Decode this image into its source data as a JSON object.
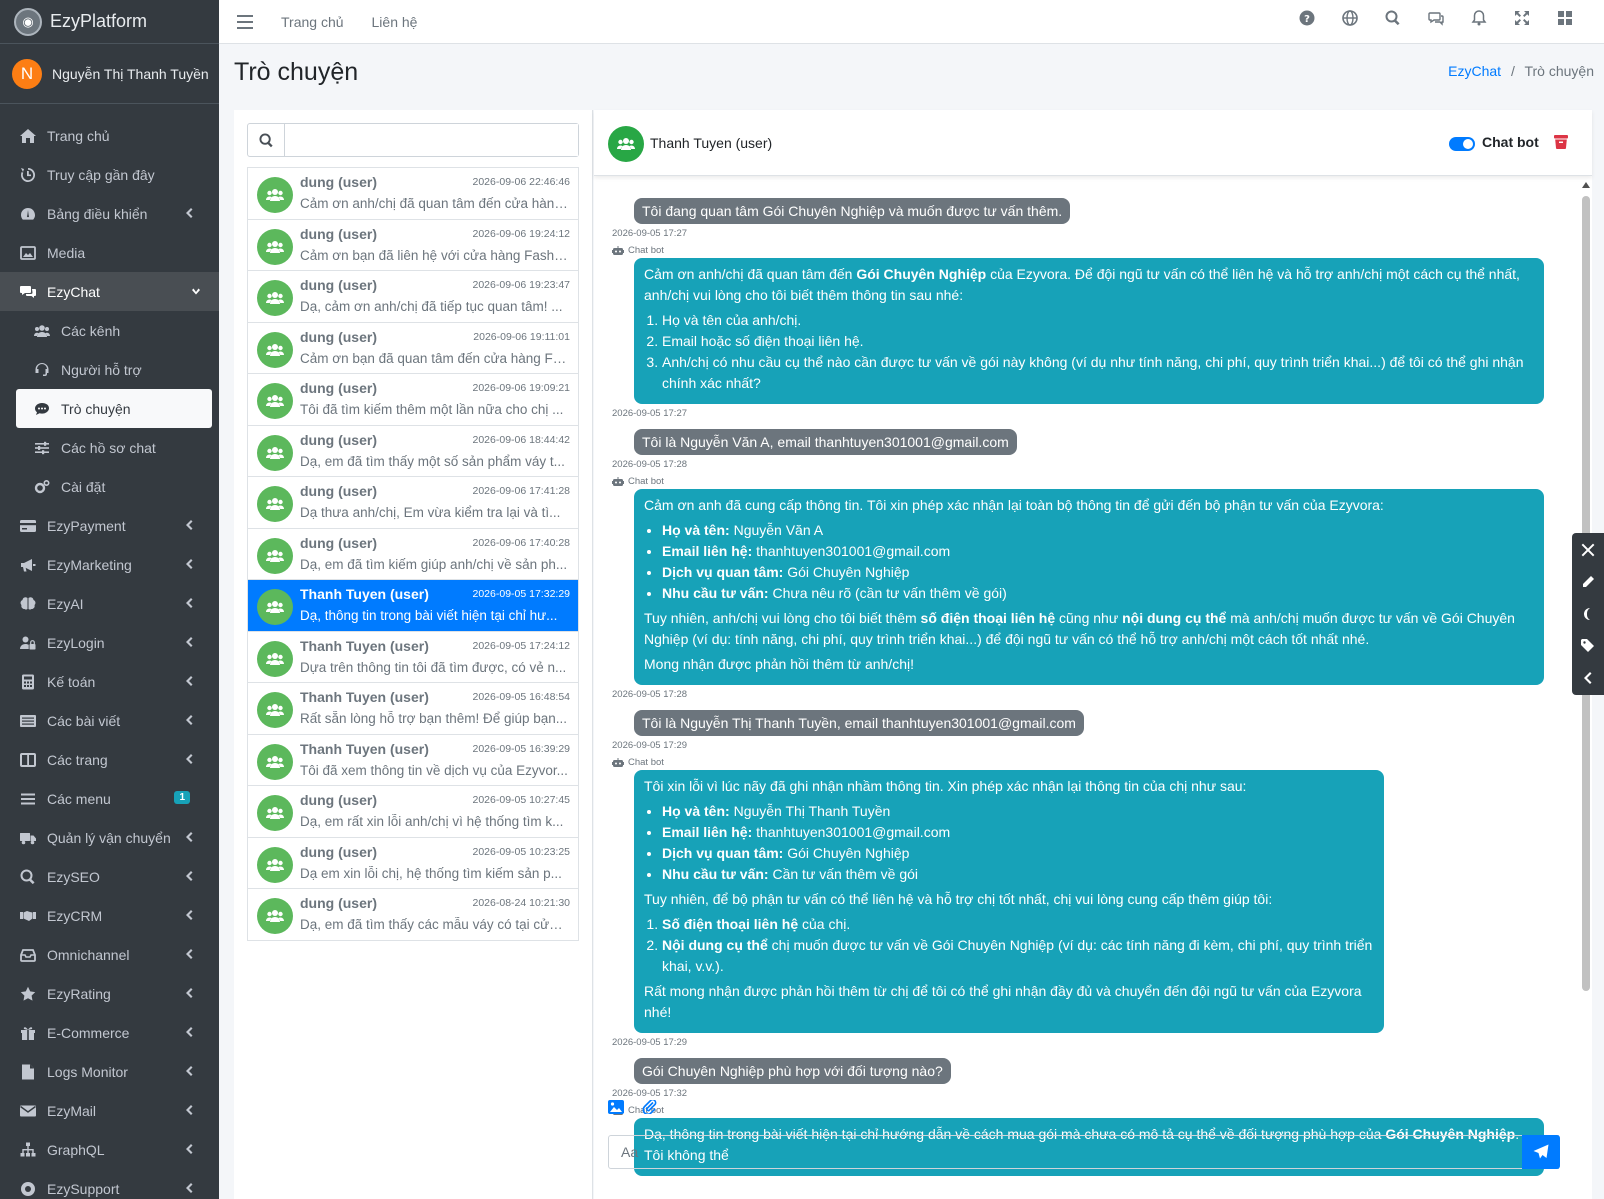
{
  "brand": {
    "name": "EzyPlatform",
    "logo_icon": "logo-icon"
  },
  "user": {
    "initial": "N",
    "name": "Nguyễn Thị Thanh Tuyền",
    "avatar_color": "#fd7e14"
  },
  "sidebar": {
    "items": [
      {
        "label": "Trang chủ",
        "icon": "home-icon"
      },
      {
        "label": "Truy cập gần đây",
        "icon": "history-icon"
      },
      {
        "label": "Bảng điều khiển",
        "icon": "dashboard-icon",
        "has_children": true
      },
      {
        "label": "Media",
        "icon": "image-icon"
      },
      {
        "label": "EzyChat",
        "icon": "comments-icon",
        "expanded": true
      },
      {
        "label": "Các kênh",
        "icon": "users-icon",
        "sub": true
      },
      {
        "label": "Người hỗ trợ",
        "icon": "headset-icon",
        "sub": true
      },
      {
        "label": "Trò chuyện",
        "icon": "comment-icon",
        "sub": true,
        "active": true
      },
      {
        "label": "Các hồ sơ chat",
        "icon": "sliders-icon",
        "sub": true
      },
      {
        "label": "Cài đặt",
        "icon": "cogs-icon",
        "sub": true
      },
      {
        "label": "EzyPayment",
        "icon": "card-icon",
        "has_children": true
      },
      {
        "label": "EzyMarketing",
        "icon": "bullhorn-icon",
        "has_children": true
      },
      {
        "label": "EzyAI",
        "icon": "brain-icon",
        "has_children": true
      },
      {
        "label": "EzyLogin",
        "icon": "user-lock-icon",
        "has_children": true
      },
      {
        "label": "Kế toán",
        "icon": "calculator-icon",
        "has_children": true
      },
      {
        "label": "Các bài viết",
        "icon": "list-icon",
        "has_children": true
      },
      {
        "label": "Các trang",
        "icon": "columns-icon",
        "has_children": true
      },
      {
        "label": "Các menu",
        "icon": "bars-icon",
        "badge": "1"
      },
      {
        "label": "Quản lý vận chuyển",
        "icon": "truck-icon",
        "has_children": true
      },
      {
        "label": "EzySEO",
        "icon": "search-icon",
        "has_children": true
      },
      {
        "label": "EzyCRM",
        "icon": "handshake-icon",
        "has_children": true
      },
      {
        "label": "Omnichannel",
        "icon": "inbox-icon",
        "has_children": true
      },
      {
        "label": "EzyRating",
        "icon": "star-icon",
        "has_children": true
      },
      {
        "label": "E-Commerce",
        "icon": "gift-icon",
        "has_children": true
      },
      {
        "label": "Logs Monitor",
        "icon": "file-icon",
        "has_children": true
      },
      {
        "label": "EzyMail",
        "icon": "envelope-icon",
        "has_children": true
      },
      {
        "label": "GraphQL",
        "icon": "sitemap-icon",
        "has_children": true
      },
      {
        "label": "EzySupport",
        "icon": "support-icon",
        "has_children": true
      }
    ]
  },
  "topbar": {
    "home": "Trang chủ",
    "contact": "Liên hệ",
    "icons": [
      "help-icon",
      "globe-icon",
      "search-icon",
      "chat-icon",
      "bell-icon",
      "expand-icon",
      "apps-icon"
    ]
  },
  "page": {
    "title": "Trò chuyện",
    "breadcrumb_root": "EzyChat",
    "breadcrumb_sep": "/",
    "breadcrumb_current": "Trò chuyện"
  },
  "search": {
    "placeholder": ""
  },
  "conversations": [
    {
      "name": "dung (user)",
      "time": "2026-09-06 22:46:46",
      "preview": "Cảm ơn anh/chị đã quan tâm đến cửa hàng Fashion..."
    },
    {
      "name": "dung (user)",
      "time": "2026-09-06 19:24:12",
      "preview": "Cảm ơn bạn đã liên hệ với cửa hàng Fashion..."
    },
    {
      "name": "dung (user)",
      "time": "2026-09-06 19:23:47",
      "preview": "Dạ, cảm ơn anh/chị đã tiếp tục quan tâm! ..."
    },
    {
      "name": "dung (user)",
      "time": "2026-09-06 19:11:01",
      "preview": "Cảm ơn bạn đã quan tâm đến cửa hàng Fa..."
    },
    {
      "name": "dung (user)",
      "time": "2026-09-06 19:09:21",
      "preview": "Tôi đã tìm kiếm thêm một lần nữa cho chị ..."
    },
    {
      "name": "dung (user)",
      "time": "2026-09-06 18:44:42",
      "preview": "Dạ, em đã tìm thấy một số sản phẩm váy t..."
    },
    {
      "name": "dung (user)",
      "time": "2026-09-06 17:41:28",
      "preview": "Dạ thưa anh/chị, Em vừa kiểm tra lại và tì..."
    },
    {
      "name": "dung (user)",
      "time": "2026-09-06 17:40:28",
      "preview": "Dạ, em đã tìm kiếm giúp anh/chị về sản ph..."
    },
    {
      "name": "Thanh Tuyen (user)",
      "time": "2026-09-05 17:32:29",
      "preview": "Dạ, thông tin trong bài viết hiện tại chỉ hư...",
      "selected": true
    },
    {
      "name": "Thanh Tuyen (user)",
      "time": "2026-09-05 17:24:12",
      "preview": "Dựa trên thông tin tôi đã tìm được, có vẻ n..."
    },
    {
      "name": "Thanh Tuyen (user)",
      "time": "2026-09-05 16:48:54",
      "preview": "Rất sẵn lòng hỗ trợ bạn thêm! Để giúp bạn..."
    },
    {
      "name": "Thanh Tuyen (user)",
      "time": "2026-09-05 16:39:29",
      "preview": "Tôi đã xem thông tin về dịch vụ của Ezyvor..."
    },
    {
      "name": "dung (user)",
      "time": "2026-09-05 10:27:45",
      "preview": "Dạ, em rất xin lỗi anh/chị vì hệ thống tìm k..."
    },
    {
      "name": "dung (user)",
      "time": "2026-09-05 10:23:25",
      "preview": "Dạ em xin lỗi chị, hệ thống tìm kiếm sản p..."
    },
    {
      "name": "dung (user)",
      "time": "2026-08-24 10:21:30",
      "preview": "Dạ, em đã tìm thấy các mẫu váy có tại cửa ..."
    }
  ],
  "chat": {
    "contact": "Thanh Tuyen (user)",
    "chatbot_label": "Chat bot",
    "chatbot_enabled": true,
    "bot_tag": "Chat bot",
    "input_placeholder": "Aa",
    "messages": [
      {
        "from": "user",
        "text": "Tôi đang quan tâm Gói Chuyên Nghiệp và muốn được tư vấn thêm.",
        "time": "2026-09-05 17:27"
      },
      {
        "from": "bot",
        "time": "2026-09-05 17:27",
        "intro": "Cảm ơn anh/chị đã quan tâm đến ",
        "intro_bold": "Gói Chuyên Nghiệp",
        "intro_rest": " của Ezyvora. Để đội ngũ tư vấn có thể liên hệ và hỗ trợ anh/chị một cách cụ thể nhất, anh/chị vui lòng cho tôi biết thêm thông tin sau nhé:",
        "list": [
          "Họ và tên của anh/chị.",
          "Email hoặc số điện thoại liên hệ.",
          "Anh/chị có nhu cầu cụ thể nào cần được tư vấn về gói này không (ví dụ như tính năng, chi phí, quy trình triển khai...) để tôi có thể ghi nhận chính xác nhất?"
        ]
      },
      {
        "from": "user",
        "text": "Tôi là Nguyễn Văn A, email thanhtuyen301001@gmail.com",
        "time": "2026-09-05 17:28"
      },
      {
        "from": "bot",
        "time": "2026-09-05 17:28",
        "intro": "Cảm ơn anh đã cung cấp thông tin. Tôi xin phép xác nhận lại toàn bộ thông tin để gửi đến bộ phận tư vấn của Ezyvora:",
        "bullets": [
          {
            "k": "Họ và tên:",
            "v": " Nguyễn Văn A"
          },
          {
            "k": "Email liên hệ:",
            "v": " thanhtuyen301001@gmail.com"
          },
          {
            "k": "Dịch vụ quan tâm:",
            "v": " Gói Chuyên Nghiệp"
          },
          {
            "k": "Nhu cầu tư vấn:",
            "v": " Chưa nêu rõ (cần tư vấn thêm về gói)"
          }
        ],
        "p1a": "Tuy nhiên, anh/chị vui lòng cho tôi biết thêm ",
        "p1b": "số điện thoại liên hệ",
        "p1c": " cũng như ",
        "p1d": "nội dung cụ thể",
        "p1e": " mà anh/chị muốn được tư vấn về Gói Chuyên Nghiệp (ví dụ: tính năng, chi phí, quy trình triển khai...) để đội ngũ tư vấn có thể hỗ trợ anh/chị một cách tốt nhất nhé.",
        "p2": "Mong nhận được phản hồi thêm từ anh/chị!"
      },
      {
        "from": "user",
        "text": "Tôi là Nguyễn Thị Thanh Tuyền, email thanhtuyen301001@gmail.com",
        "time": "2026-09-05 17:29"
      },
      {
        "from": "bot",
        "time": "2026-09-05 17:29",
        "intro": "Tôi xin lỗi vì lúc nãy đã ghi nhận nhầm thông tin. Xin phép xác nhận lại thông tin của chị như sau:",
        "bullets": [
          {
            "k": "Họ và tên:",
            "v": " Nguyễn Thị Thanh Tuyền"
          },
          {
            "k": "Email liên hệ:",
            "v": " thanhtuyen301001@gmail.com"
          },
          {
            "k": "Dịch vụ quan tâm:",
            "v": " Gói Chuyên Nghiệp"
          },
          {
            "k": "Nhu cầu tư vấn:",
            "v": " Cần tư vấn thêm về gói"
          }
        ],
        "p1": "Tuy nhiên, để bộ phận tư vấn có thể liên hệ và hỗ trợ chị tốt nhất, chị vui lòng cung cấp thêm giúp tôi:",
        "ol": [
          {
            "k": "Số điện thoại liên hệ",
            "v": " của chị."
          },
          {
            "k": "Nội dung cụ thể",
            "v": " chị muốn được tư vấn về Gói Chuyên Nghiệp (ví dụ: các tính năng đi kèm, chi phí, quy trình triển khai, v.v.)."
          }
        ],
        "p2": "Rất mong nhận được phản hồi thêm từ chị để tôi có thể ghi nhận đầy đủ và chuyển đến đội ngũ tư vấn của Ezyvora nhé!"
      },
      {
        "from": "user",
        "text": "Gói Chuyên Nghiệp phù hợp với đối tượng nào?",
        "time": "2026-09-05 17:32"
      },
      {
        "from": "bot",
        "intro": "Dạ, thông tin trong bài viết hiện tại chỉ hướng dẫn về cách mua gói mà chưa có mô tả cụ thể về đối tượng phù hợp của ",
        "intro_bold": "Gói Chuyên Nghiệp",
        "intro_rest": ". Tôi không thể"
      }
    ]
  },
  "colors": {
    "sidebar_bg": "#343a40",
    "primary": "#007bff",
    "bot_bubble": "#17a2b8",
    "user_bubble": "#6c757d",
    "avatar_green": "#5cb85c"
  }
}
